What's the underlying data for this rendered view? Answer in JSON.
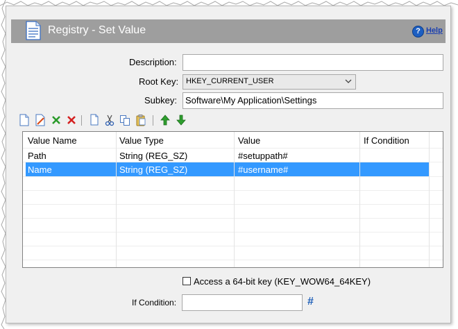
{
  "window": {
    "title": "Registry - Set Value",
    "help_label": "Help",
    "help_icon": "question-icon",
    "header_icon": "document-icon"
  },
  "form": {
    "description_label": "Description:",
    "description_value": "",
    "root_key_label": "Root Key:",
    "root_key_value": "HKEY_CURRENT_USER",
    "subkey_label": "Subkey:",
    "subkey_value": "Software\\My Application\\Settings"
  },
  "toolbar": {
    "icons": [
      "new-icon",
      "edit-icon",
      "delete-icon",
      "delete-all-icon",
      "copy-page-icon",
      "cut-icon",
      "copy-icon",
      "paste-icon",
      "move-up-icon",
      "move-down-icon"
    ]
  },
  "grid": {
    "columns": [
      "Value Name",
      "Value Type",
      "Value",
      "If Condition"
    ],
    "rows": [
      {
        "name": "Path",
        "type": "String (REG_SZ)",
        "value": "#setuppath#",
        "condition": ""
      },
      {
        "name": "Name",
        "type": "String (REG_SZ)",
        "value": "#username#",
        "condition": ""
      }
    ],
    "selected_row": 1
  },
  "options": {
    "access64_label": "Access a 64-bit key (KEY_WOW64_64KEY)",
    "access64_checked": false,
    "if_condition_label": "If Condition:",
    "if_condition_value": "",
    "hash_label": "#"
  },
  "colors": {
    "header_bg": "#9e9e9e",
    "selection": "#3399ff",
    "panel_bg": "#f0f0f0"
  }
}
